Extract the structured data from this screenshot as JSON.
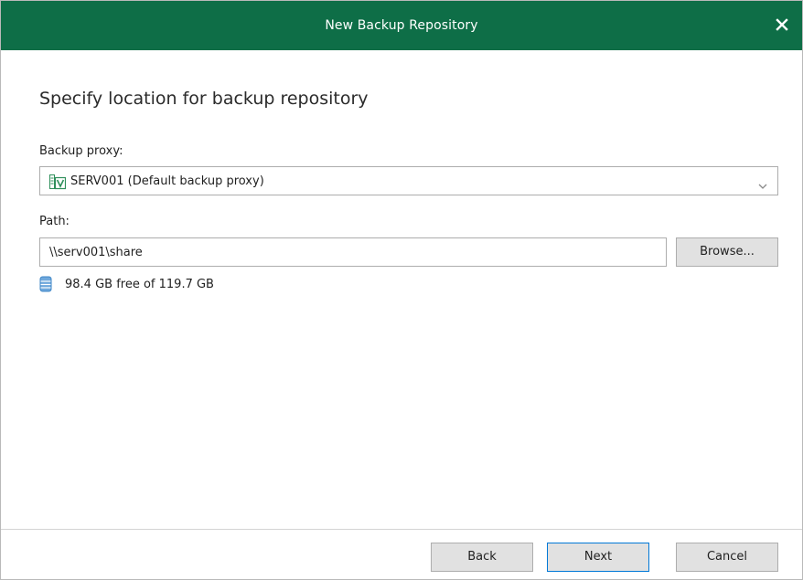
{
  "window": {
    "title": "New Backup Repository",
    "close_icon": "close-icon"
  },
  "step": {
    "heading": "Specify location for backup repository"
  },
  "backup_proxy": {
    "label": "Backup proxy:",
    "selected_value": "SERV001 (Default backup proxy)",
    "icon": "server-proxy-icon"
  },
  "path": {
    "label": "Path:",
    "value": "\\\\serv001\\share",
    "browse_label": "Browse..."
  },
  "space": {
    "icon": "database-icon",
    "text": "98.4 GB free of 119.7 GB"
  },
  "footer": {
    "back_label": "Back",
    "next_label": "Next",
    "cancel_label": "Cancel"
  },
  "colors": {
    "titlebar": "#0e6e47",
    "accent": "#0078d7"
  }
}
